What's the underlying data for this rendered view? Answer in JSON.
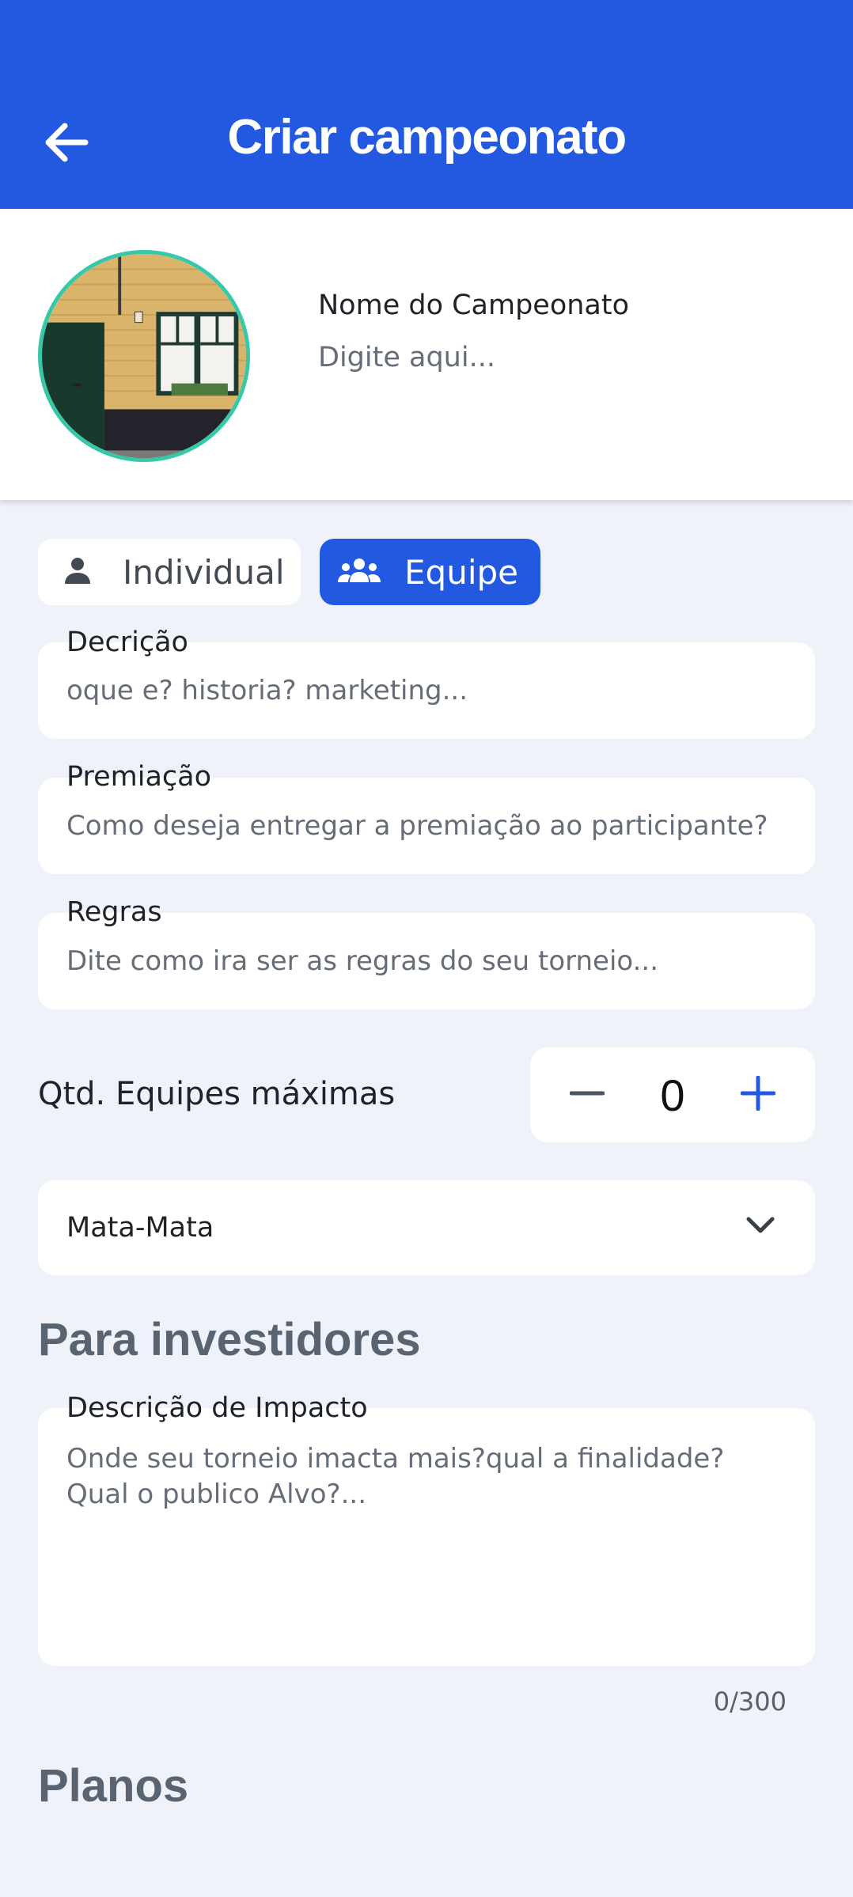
{
  "appbar": {
    "title": "Criar campeonato",
    "back_icon": "arrow-left-icon",
    "color": "#2358e0"
  },
  "header": {
    "avatar_icon": "championship-photo",
    "avatar_border_color": "#37c7a9",
    "name_label": "Nome do Campeonato",
    "name_placeholder": "Digite aqui..."
  },
  "mode_toggle": {
    "individual": {
      "label": "Individual",
      "icon": "person-icon",
      "selected": false
    },
    "equipe": {
      "label": "Equipe",
      "icon": "group-icon",
      "selected": true
    }
  },
  "fields": {
    "descricao": {
      "label": "Decrição",
      "placeholder": "oque e? historia? marketing..."
    },
    "premiacao": {
      "label": "Premiação",
      "placeholder": "Como deseja entregar a premiação ao participante?"
    },
    "regras": {
      "label": "Regras",
      "placeholder": "Dite como ira ser as regras do seu torneio..."
    }
  },
  "max_teams": {
    "label": "Qtd. Equipes máximas",
    "value": "0",
    "minus_icon": "minus-icon",
    "plus_icon": "plus-icon"
  },
  "format_select": {
    "value": "Mata-Mata",
    "icon": "chevron-down-icon"
  },
  "investors": {
    "title": "Para investidores",
    "impact_label": "Descrição de Impacto",
    "impact_placeholder": "Onde seu torneio imacta mais?qual a finalidade? Qual o publico Alvo?...",
    "counter": "0/300"
  },
  "plans": {
    "title": "Planos"
  }
}
